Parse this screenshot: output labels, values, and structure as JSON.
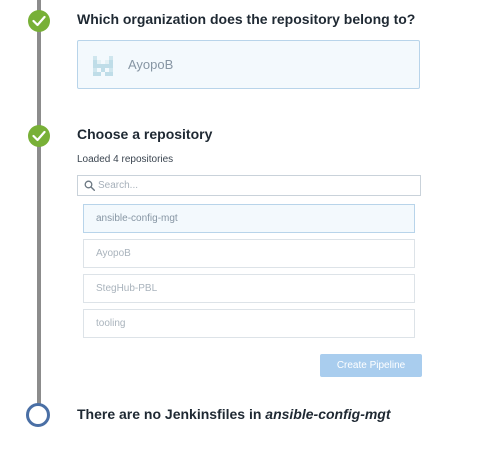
{
  "steps": [
    {
      "title": "Which organization does the repository belong to?",
      "status": "done"
    },
    {
      "title": "Choose a repository",
      "status": "done"
    },
    {
      "title_prefix": "There are no Jenkinsfiles in ",
      "title_emphasis": "ansible-config-mgt",
      "status": "pending"
    }
  ],
  "organization": {
    "name": "AyopoB",
    "avatar_icon": "pixel-identicon"
  },
  "repositories": {
    "loaded_text": "Loaded 4 repositories",
    "search_placeholder": "Search...",
    "items": [
      {
        "name": "ansible-config-mgt",
        "selected": true
      },
      {
        "name": "AyopoB",
        "selected": false
      },
      {
        "name": "StegHub-PBL",
        "selected": false
      },
      {
        "name": "tooling",
        "selected": false
      }
    ]
  },
  "actions": {
    "create_pipeline_label": "Create Pipeline"
  },
  "colors": {
    "done_marker": "#78b037",
    "pending_marker_border": "#4a6fa5",
    "timeline": "#8c8c8c",
    "button_disabled": "#a9cdee",
    "selected_border": "#b8d4ea"
  }
}
